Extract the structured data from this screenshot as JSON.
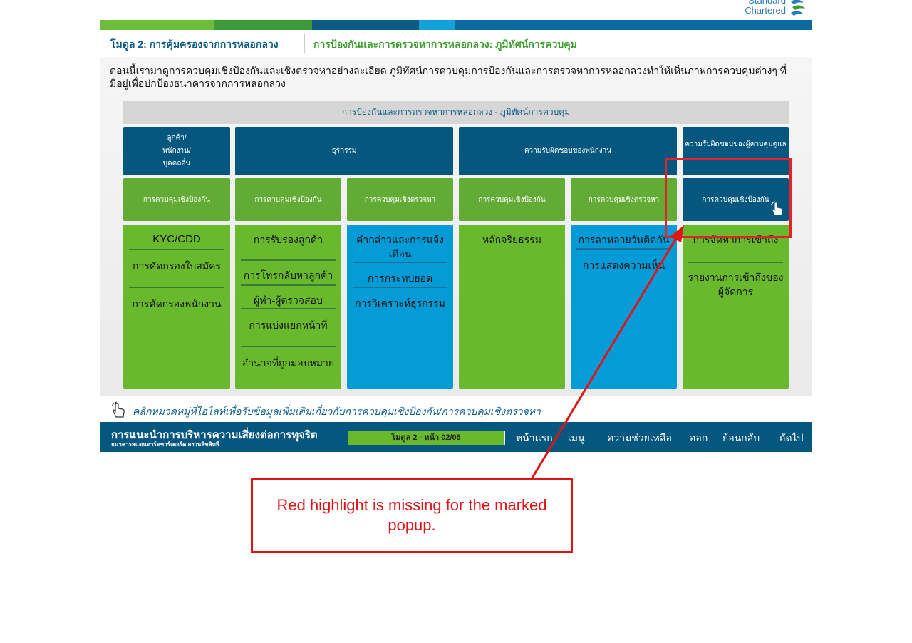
{
  "brand": {
    "name_line1": "Standard",
    "name_line2": "Chartered",
    "accent": "#0b5b84",
    "green": "#69b92d",
    "blue": "#049bd6"
  },
  "module": {
    "title": "โมดูล 2: การคุ้มครองจากการหลอกลวง",
    "subtitle": "การป้องกันและการตรวจหาการหลอกลวง: ภูมิทัศน์การควบคุม"
  },
  "intro": "ตอนนี้เรามาดูการควบคุมเชิงป้องกันและเชิงตรวจหาอย่างละเอียด ภูมิทัศน์การควบคุมการป้องกันและการตรวจหาการหลอกลวงทำให้เห็นภาพการควบคุมต่างๆ ที่มีอยู่เพื่อปกป้องธนาคารจากการหลอกลวง",
  "grid": {
    "title": "การป้องกันและการตรวจหาการหลอกลวง - ภูมิทัศน์การควบคุม",
    "headers": [
      "ลูกค้า/\nพนักงาน/\nบุคคลอื่น",
      "ธุรกรรม",
      "ความรับผิดชอบของพนักงาน",
      "ความรับผิดชอบของผู้ควบคุมดูแล"
    ],
    "subheaders": [
      "การควบคุมเชิงป้องกัน",
      "การควบคุมเชิงป้องกัน",
      "การควบคุมเชิงตรวจหา",
      "การควบคุมเชิงป้องกัน",
      "การควบคุมเชิงตรวจหา",
      "การควบคุมเชิงป้องกัน"
    ],
    "columns": [
      {
        "items": [
          "KYC/CDD",
          "การคัดกรองใบสมัคร",
          "การคัดกรองพนักงาน"
        ]
      },
      {
        "items": [
          "การรับรองลูกค้า",
          "การโทรกลับหาลูกค้า",
          "ผู้ทำ-ผู้ตรวจสอบ",
          "การแบ่งแยกหน้าที่",
          "อำนาจที่ถูกมอบหมาย"
        ]
      },
      {
        "items": [
          "คำกล่าวและการแจ้งเตือน",
          "การกระทบยอด",
          "การวิเคราะห์ธุรกรรม"
        ]
      },
      {
        "items": [
          "หลักจริยธรรม"
        ]
      },
      {
        "items": [
          "การลาหลายวันติดกัน",
          "การแสดงความเห็น"
        ]
      },
      {
        "items": [
          "การจัดหาการเข้าถึง",
          "รายงานการเข้าถึงของผู้จัดการ"
        ]
      }
    ]
  },
  "hint": "คลิกหมวดหมู่ที่ไฮไลท์เพื่อรับข้อมูลเพิ่มเติมเกี่ยวกับการควบคุมเชิงป้องกัน/การควบคุมเชิงตรวจหา",
  "footer": {
    "title": "การแนะนำการบริหารความเสี่ยงต่อการทุจริต",
    "subtitle": "ธนาคารสแตนดาร์ดชาร์เตอร์ด สงวนลิขสิทธิ์",
    "page": "โมดูล 2 - หน้า 02/05",
    "nav": [
      "หน้าแรก",
      "เมนู",
      "ความช่วยเหลือ",
      "ออก",
      "ย้อนกลับ",
      "ถัดไป"
    ]
  },
  "annotation": {
    "note": "Red highlight is missing for the marked popup.",
    "color": "#e11414"
  }
}
